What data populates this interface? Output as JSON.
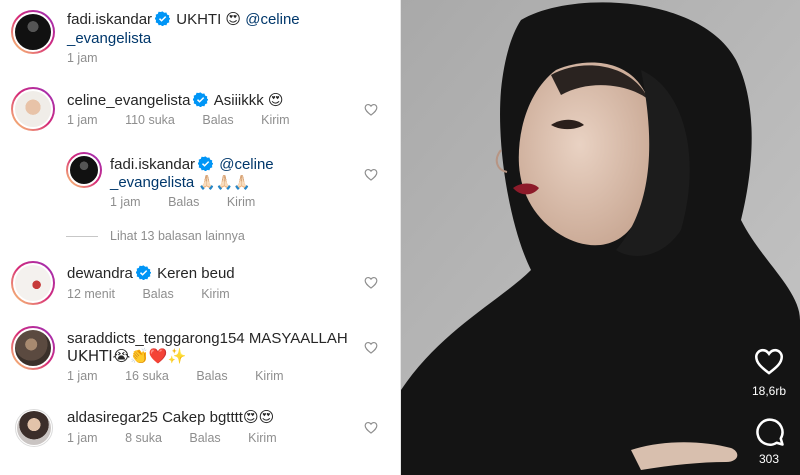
{
  "comments": [
    {
      "username": "fadi.iskandar",
      "verified": true,
      "text": "UKHTI 😍",
      "mention_part1": "@celine",
      "mention_part2": "_evangelista",
      "time": "1 jam"
    },
    {
      "username": "celine_evangelista",
      "verified": true,
      "text": "Asiiikkk 😍",
      "time": "1 jam",
      "likes": "110 suka",
      "reply": "Balas",
      "send": "Kirim"
    },
    {
      "username": "fadi.iskandar",
      "verified": true,
      "mention_part1": "@celine",
      "mention_part2": "_evangelista",
      "emoji": "🙏🏻🙏🏻🙏🏻",
      "time": "1 jam",
      "reply": "Balas",
      "send": "Kirim"
    },
    {
      "username": "dewandra",
      "verified": true,
      "text": "Keren beud",
      "time": "12 menit",
      "reply": "Balas",
      "send": "Kirim"
    },
    {
      "username": "saraddicts_tenggarong154",
      "text_part1": "MASYAALLAH",
      "text_part2": "UKHTI😭👏❤️✨",
      "time": "1 jam",
      "likes": "16 suka",
      "reply": "Balas",
      "send": "Kirim"
    },
    {
      "username": "aldasiregar25",
      "text": "Cakep bgtttt😍😍",
      "time": "1 jam",
      "likes": "8 suka",
      "reply": "Balas",
      "send": "Kirim"
    }
  ],
  "view_more": "Lihat 13 balasan lainnya",
  "video": {
    "like_count": "18,6rb",
    "comment_count": "303"
  },
  "colors": {
    "verified": "#0095f6",
    "mention": "#00376b",
    "meta": "#8e8e8e"
  }
}
